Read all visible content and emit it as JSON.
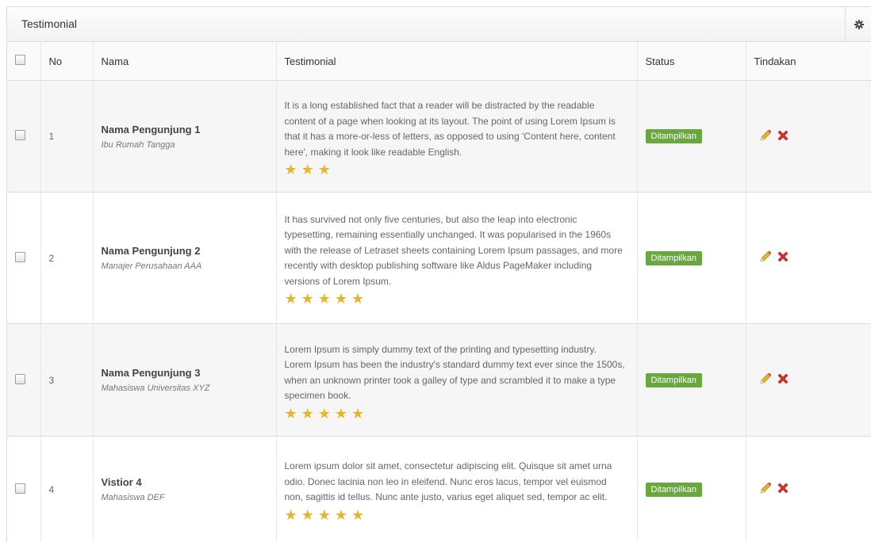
{
  "panel": {
    "title": "Testimonial"
  },
  "columns": {
    "no": "No",
    "nama": "Nama",
    "testimonial": "Testimonial",
    "status": "Status",
    "tindakan": "Tindakan"
  },
  "rows": [
    {
      "no": "1",
      "name": "Nama Pengunjung 1",
      "role": "Ibu Rumah Tangga",
      "text": "It is a long established fact that a reader will be distracted by the readable content of a page when looking at its layout. The point of using Lorem Ipsum is that it has a more-or-less of letters, as opposed to using 'Content here, content here', making it look like readable English.",
      "stars": "★★★",
      "rating": 3,
      "status": "Ditampilkan"
    },
    {
      "no": "2",
      "name": "Nama Pengunjung 2",
      "role": "Manajer Perusahaan AAA",
      "text": "It has survived not only five centuries, but also the leap into electronic typesetting, remaining essentially unchanged. It was popularised in the 1960s with the release of Letraset sheets containing Lorem Ipsum passages, and more recently with desktop publishing software like Aldus PageMaker including versions of Lorem Ipsum.",
      "stars": "★★★★★",
      "rating": 5,
      "status": "Ditampilkan"
    },
    {
      "no": "3",
      "name": "Nama Pengunjung 3",
      "role": "Mahasiswa Universitas XYZ",
      "text": "Lorem Ipsum is simply dummy text of the printing and typesetting industry. Lorem Ipsum has been the industry's standard dummy text ever since the 1500s, when an unknown printer took a galley of type and scrambled it to make a type specimen book.",
      "stars": "★★★★★",
      "rating": 5,
      "status": "Ditampilkan"
    },
    {
      "no": "4",
      "name": "Vistior 4",
      "role": "Mahasiswa DEF",
      "text": "Lorem ipsum dolor sit amet, consectetur adipiscing elit. Quisque sit amet urna odio. Donec lacinia non leo in eleifend. Nunc eros lacus, tempor vel euismod non, sagittis id tellus. Nunc ante justo, varius eget aliquet sed, tempor ac elit.",
      "stars": "★★★★★",
      "rating": 5,
      "status": "Ditampilkan"
    }
  ],
  "colors": {
    "badge": "#69a73f",
    "star": "#e8b52a",
    "delete": "#d9302c",
    "edit": "#e0b431"
  },
  "icons": {
    "settings": "gear-icon",
    "edit": "pencil-icon",
    "delete": "close-icon"
  }
}
